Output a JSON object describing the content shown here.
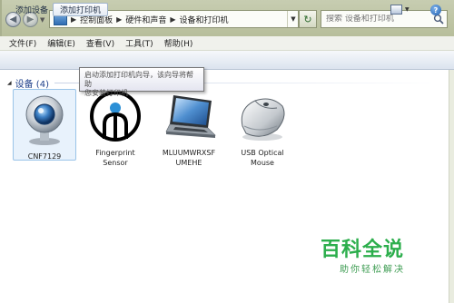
{
  "address_bar": {
    "breadcrumbs": [
      "控制面板",
      "硬件和声音",
      "设备和打印机"
    ]
  },
  "search": {
    "placeholder": "搜索 设备和打印机"
  },
  "menu": [
    "文件(F)",
    "编辑(E)",
    "查看(V)",
    "工具(T)",
    "帮助(H)"
  ],
  "toolbar": {
    "add_device": "添加设备",
    "add_printer": "添加打印机",
    "help": "?"
  },
  "tooltip": {
    "line1": "启动添加打印机向导，该向导将帮助",
    "line2": "您安装打印机"
  },
  "group": {
    "label": "设备 (4)"
  },
  "devices": [
    {
      "line1": "CNF7129",
      "line2": "",
      "icon": "webcam-icon"
    },
    {
      "line1": "Fingerprint",
      "line2": "Sensor",
      "icon": "fingerprint-sensor-icon"
    },
    {
      "line1": "MLUUMWRXSF",
      "line2": "UMEHE",
      "icon": "laptop-icon"
    },
    {
      "line1": "USB Optical",
      "line2": "Mouse",
      "icon": "mouse-icon"
    }
  ],
  "watermark": {
    "title": "百科全说",
    "subtitle": "助你轻松解决"
  },
  "colors": {
    "selection": "#e8f2fc",
    "group_header": "#1e3f8a",
    "watermark": "#2cae4c"
  }
}
